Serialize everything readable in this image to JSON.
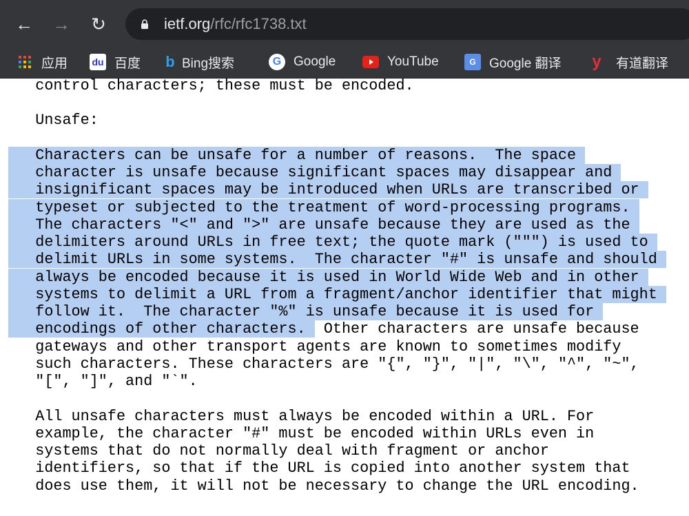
{
  "browser": {
    "url_host": "ietf.org",
    "url_path": "/rfc/rfc1738.txt",
    "bookmarks": [
      {
        "label": "应用",
        "icon": "apps-grid-icon"
      },
      {
        "label": "百度",
        "icon": "baidu-icon"
      },
      {
        "label": "Bing搜索",
        "icon": "bing-icon"
      },
      {
        "label": "Google",
        "icon": "google-icon"
      },
      {
        "label": "YouTube",
        "icon": "youtube-icon"
      },
      {
        "label": "Google 翻译",
        "icon": "google-translate-icon"
      },
      {
        "label": "有道翻译",
        "icon": "youdao-icon"
      }
    ]
  },
  "content": {
    "lines": [
      {
        "sel": "",
        "rest": "   control characters; these must be encoded."
      },
      {
        "sel": "",
        "rest": ""
      },
      {
        "sel": "",
        "rest": "   Unsafe:"
      },
      {
        "sel": "",
        "rest": ""
      },
      {
        "sel": "   Characters can be unsafe for a number of reasons.  The space ",
        "rest": ""
      },
      {
        "sel": "   character is unsafe because significant spaces may disappear and ",
        "rest": ""
      },
      {
        "sel": "   insignificant spaces may be introduced when URLs are transcribed or ",
        "rest": ""
      },
      {
        "sel": "   typeset or subjected to the treatment of word-processing programs. ",
        "rest": ""
      },
      {
        "sel": "   The characters \"<\" and \">\" are unsafe because they are used as the ",
        "rest": ""
      },
      {
        "sel": "   delimiters around URLs in free text; the quote mark (\"\"\") is used to ",
        "rest": ""
      },
      {
        "sel": "   delimit URLs in some systems.  The character \"#\" is unsafe and should ",
        "rest": ""
      },
      {
        "sel": "   always be encoded because it is used in World Wide Web and in other ",
        "rest": ""
      },
      {
        "sel": "   systems to delimit a URL from a fragment/anchor identifier that might ",
        "rest": ""
      },
      {
        "sel": "   follow it.  The character \"%\" is unsafe because it is used for ",
        "rest": ""
      },
      {
        "sel": "   encodings of other characters. ",
        "rest": " Other characters are unsafe because"
      },
      {
        "sel": "",
        "rest": "   gateways and other transport agents are known to sometimes modify"
      },
      {
        "sel": "",
        "rest": "   such characters. These characters are \"{\", \"}\", \"|\", \"\\\", \"^\", \"~\","
      },
      {
        "sel": "",
        "rest": "   \"[\", \"]\", and \"`\"."
      },
      {
        "sel": "",
        "rest": ""
      },
      {
        "sel": "",
        "rest": "   All unsafe characters must always be encoded within a URL. For"
      },
      {
        "sel": "",
        "rest": "   example, the character \"#\" must be encoded within URLs even in"
      },
      {
        "sel": "",
        "rest": "   systems that do not normally deal with fragment or anchor"
      },
      {
        "sel": "",
        "rest": "   identifiers, so that if the URL is copied into another system that"
      },
      {
        "sel": "",
        "rest": "   does use them, it will not be necessary to change the URL encoding."
      }
    ]
  },
  "colors": {
    "selection": "#b5cff3",
    "chrome": "#35363a"
  }
}
